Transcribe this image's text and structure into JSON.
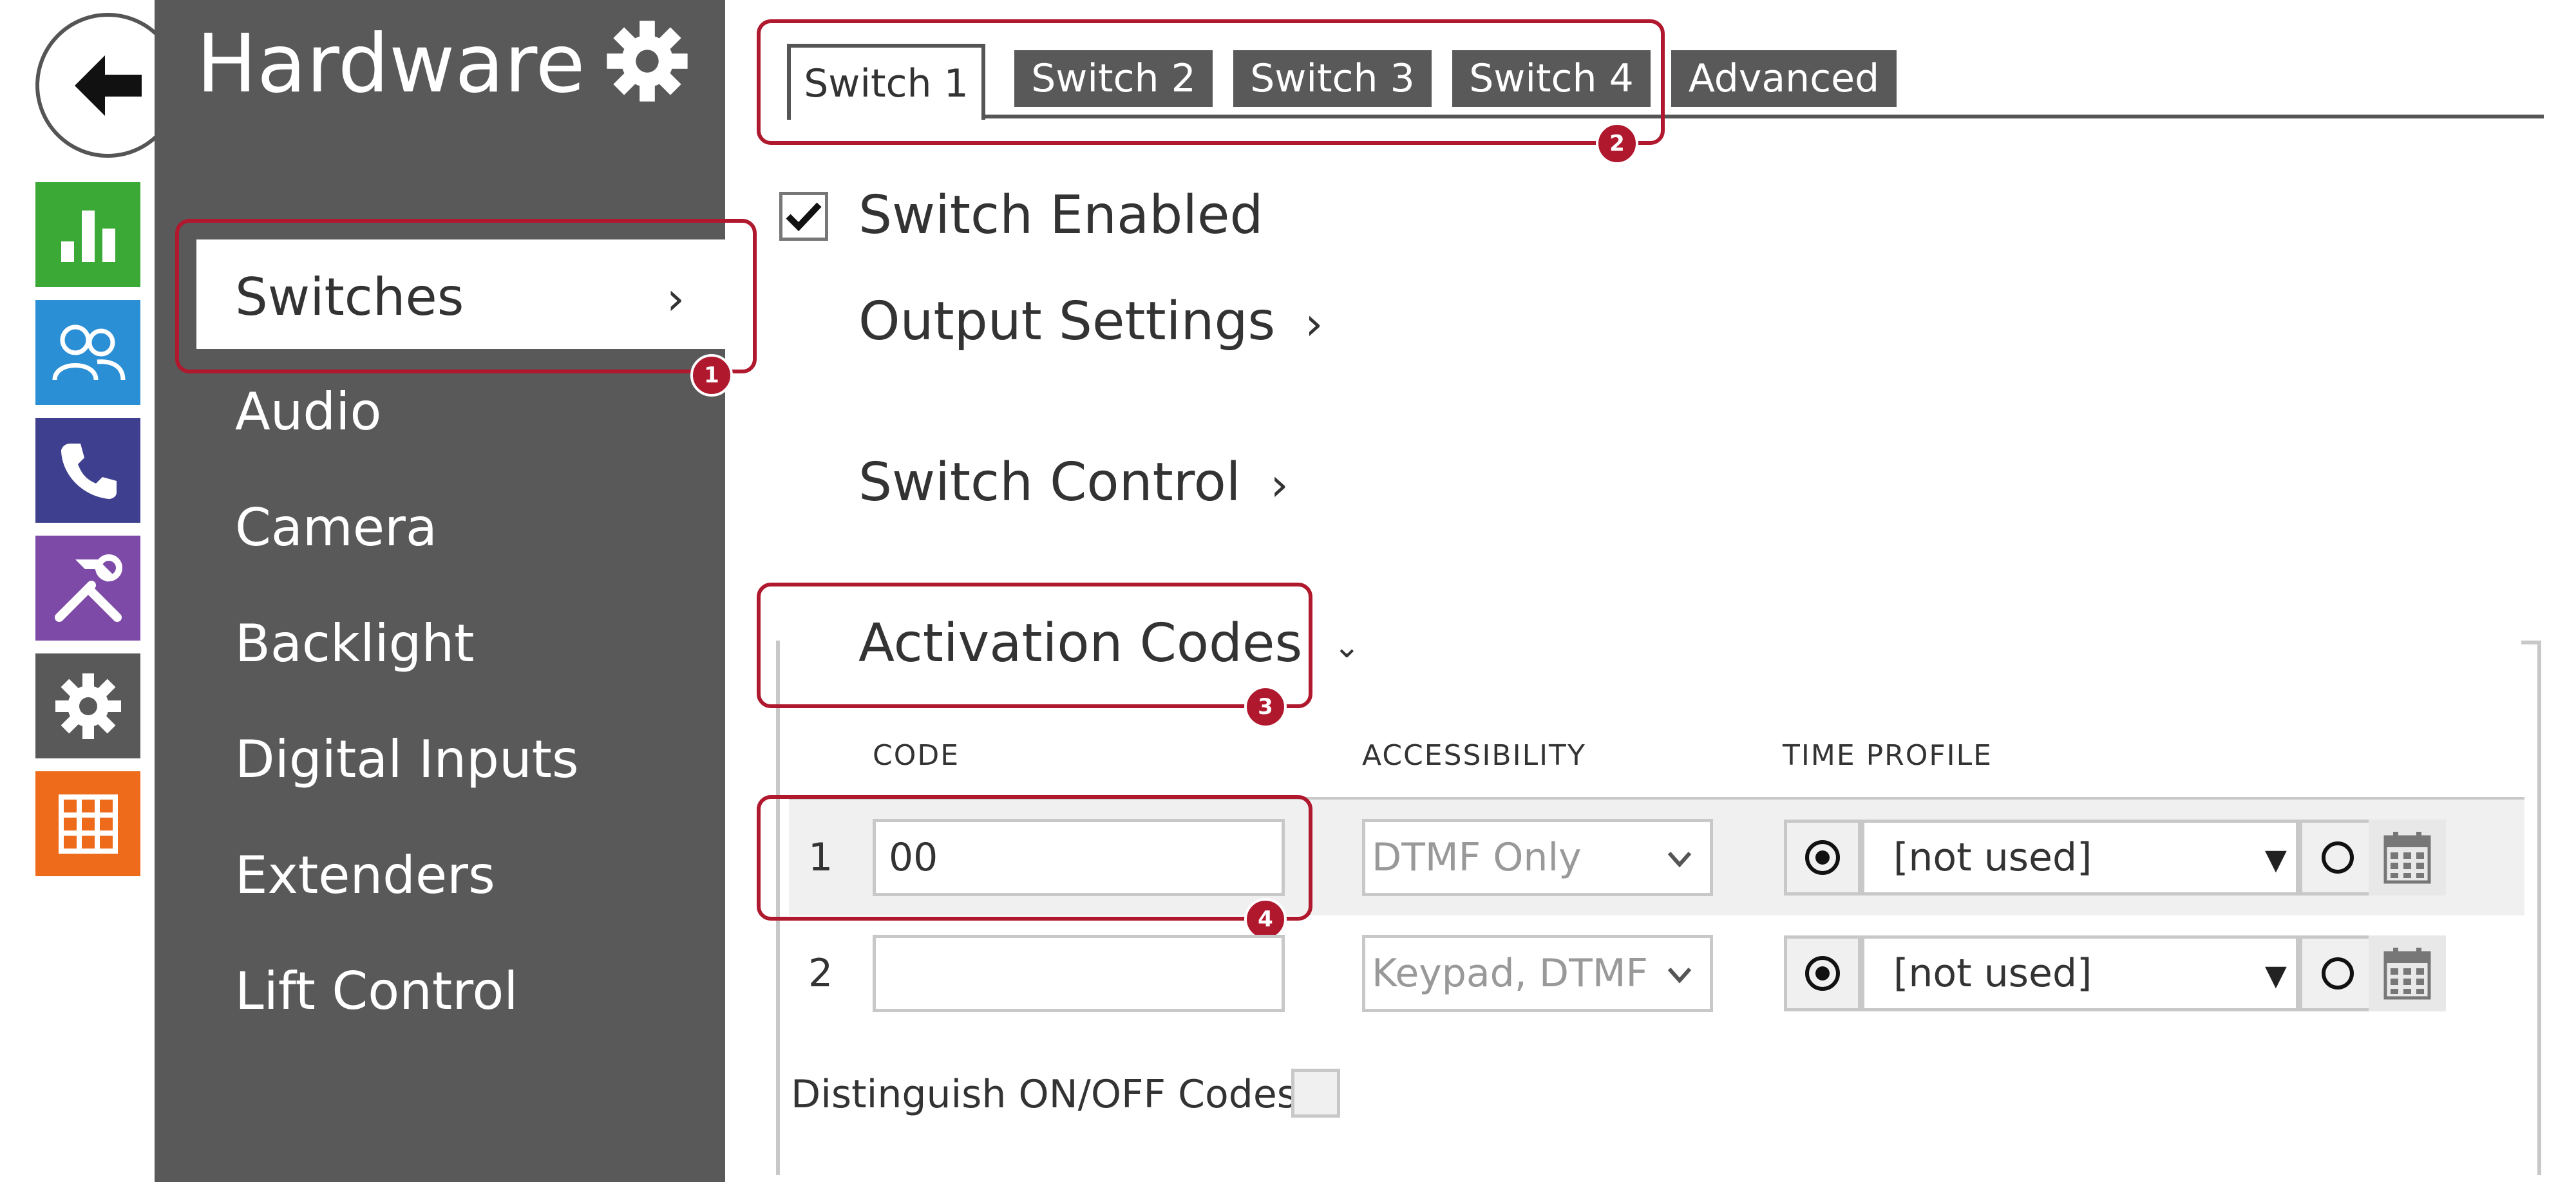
{
  "rail": {
    "back_icon": "arrow-left-icon",
    "icons": [
      {
        "name": "status-icon",
        "color": "#3aa935"
      },
      {
        "name": "directory-icon",
        "color": "#2b8fd6"
      },
      {
        "name": "phone-icon",
        "color": "#3e3f8f"
      },
      {
        "name": "services-icon",
        "color": "#7e4aa8"
      },
      {
        "name": "hardware-icon",
        "color": "#595959"
      },
      {
        "name": "system-icon",
        "color": "#ee6b1b"
      }
    ]
  },
  "sidebar": {
    "title": "Hardware",
    "items": [
      {
        "label": "Switches",
        "active": true
      },
      {
        "label": "Audio"
      },
      {
        "label": "Camera"
      },
      {
        "label": "Backlight"
      },
      {
        "label": "Digital Inputs"
      },
      {
        "label": "Extenders"
      },
      {
        "label": "Lift Control"
      }
    ]
  },
  "tabs": [
    {
      "label": "Switch 1",
      "active": true
    },
    {
      "label": "Switch 2"
    },
    {
      "label": "Switch 3"
    },
    {
      "label": "Switch 4"
    },
    {
      "label": "Advanced"
    }
  ],
  "main": {
    "switch_enabled_label": "Switch Enabled",
    "switch_enabled_checked": true,
    "output_settings": "Output Settings",
    "switch_control": "Switch Control",
    "activation_codes": "Activation Codes",
    "columns": {
      "code": "CODE",
      "accessibility": "ACCESSIBILITY",
      "time_profile": "TIME PROFILE"
    },
    "rows": [
      {
        "index": "1",
        "code": "00",
        "accessibility": "DTMF Only",
        "time_profile": "[not used]"
      },
      {
        "index": "2",
        "code": "",
        "accessibility": "Keypad, DTMF",
        "time_profile": "[not used]"
      }
    ],
    "distinguish_label": "Distinguish ON/OFF Codes"
  },
  "annotations": [
    "1",
    "2",
    "3",
    "4"
  ],
  "colors": {
    "accent": "#b0182e",
    "sidebar": "#595959"
  }
}
